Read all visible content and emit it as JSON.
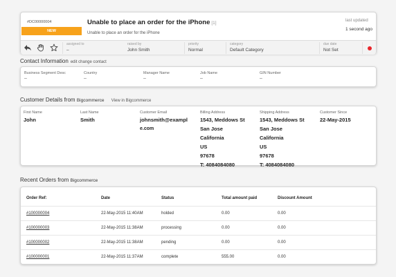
{
  "ticket": {
    "id": "#DC00000004",
    "status": "NEW",
    "title": "Unable to place an order for the iPhone",
    "count": "[1]",
    "description": "Unable to place an order for the iPhone",
    "last_updated_label": "last updated",
    "last_updated_value": "1 second ago",
    "status_color": "#f7a21b",
    "priority_color": "#e8262b",
    "fields": {
      "assigned_to": {
        "label": "assigned to",
        "value": "–"
      },
      "raised_by": {
        "label": "raised by",
        "value": "John Smith"
      },
      "priority": {
        "label": "priority",
        "value": "Normal"
      },
      "category": {
        "label": "category",
        "value": "Default Category"
      },
      "due_date": {
        "label": "due date",
        "value": "Not Set"
      }
    },
    "tools": [
      "reply-arrow-icon",
      "hand-icon",
      "star-icon"
    ]
  },
  "contact": {
    "title": "Contact Information",
    "edit_link": "edit change contact",
    "columns": [
      {
        "label": "Business Segment Desc",
        "value": "–"
      },
      {
        "label": "Country",
        "value": "–"
      },
      {
        "label": "Manager Name",
        "value": "–"
      },
      {
        "label": "Job Name",
        "value": "–"
      },
      {
        "label": "GIN Number",
        "value": "–"
      }
    ]
  },
  "customer": {
    "title": "Customer Details from",
    "brand": "Bigcommerce",
    "view_link": "View in Bigcommerce",
    "first_name": {
      "label": "First Name",
      "value": "John"
    },
    "last_name": {
      "label": "Last Name",
      "value": "Smith"
    },
    "email": {
      "label": "Customer Email",
      "line1": "johnsmith@exampl",
      "line2": "e.com"
    },
    "billing": {
      "label": "Billing Address",
      "lines": [
        "1543, Meddows St",
        "San Jose",
        "California",
        "US",
        "97678",
        "T: 4084084080"
      ]
    },
    "shipping": {
      "label": "Shipping Address",
      "lines": [
        "1543, Meddows St",
        "San Jose",
        "California",
        "US",
        "97678",
        "T: 4084084080"
      ]
    },
    "since": {
      "label": "Customer Since",
      "value": "22-May-2015"
    }
  },
  "orders": {
    "title": "Recent Orders from",
    "brand": "Bigcommerce",
    "headers": [
      "Order Ref:",
      "Date",
      "Status",
      "Total amount paid",
      "Discount Amount"
    ],
    "rows": [
      [
        "#100000004",
        "22-May-2015 11:40AM",
        "holded",
        "0.00",
        "0.00"
      ],
      [
        "#100000003",
        "22-May-2015 11:38AM",
        "processing",
        "0.00",
        "0.00"
      ],
      [
        "#100000002",
        "22-May-2015 11:38AM",
        "pending",
        "0.00",
        "0.00"
      ],
      [
        "#100000001",
        "22-May-2015 11:37AM",
        "complete",
        "555.00",
        "0.00"
      ]
    ]
  }
}
